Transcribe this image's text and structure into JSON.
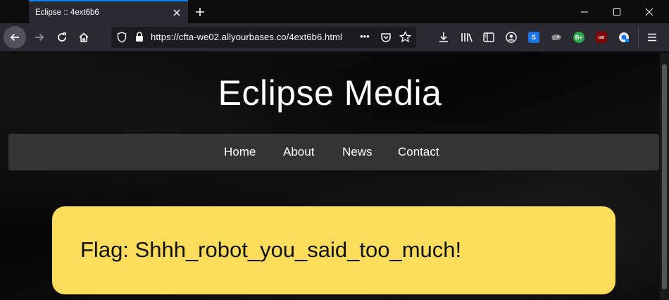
{
  "browser": {
    "tab_title": "Eclipse :: 4ext6b6",
    "url": "https://cfta-we02.allyourbases.co/4ext6b6.html",
    "url_more": "•••",
    "extensions": [
      {
        "name": "stylus-icon",
        "label": "S",
        "color": "#1a73e8"
      },
      {
        "name": "chameleon-icon",
        "label": "",
        "color": "#8a8a8a"
      },
      {
        "name": "bplus-icon",
        "label": "B+",
        "color": "#2aa84a"
      },
      {
        "name": "ublock-icon",
        "label": "uo",
        "color": "#800000"
      },
      {
        "name": "privacy-extension-icon",
        "label": "",
        "color": "#e8e8e8"
      }
    ]
  },
  "site": {
    "title": "Eclipse Media",
    "nav": [
      {
        "label": "Home"
      },
      {
        "label": "About"
      },
      {
        "label": "News"
      },
      {
        "label": "Contact"
      }
    ],
    "flag_text": "Flag: Shhh_robot_you_said_too_much!"
  },
  "colors": {
    "tab_accent": "#0a84ff",
    "flag_background": "#fcdc5b",
    "menu_background": "#3c3c3c"
  }
}
